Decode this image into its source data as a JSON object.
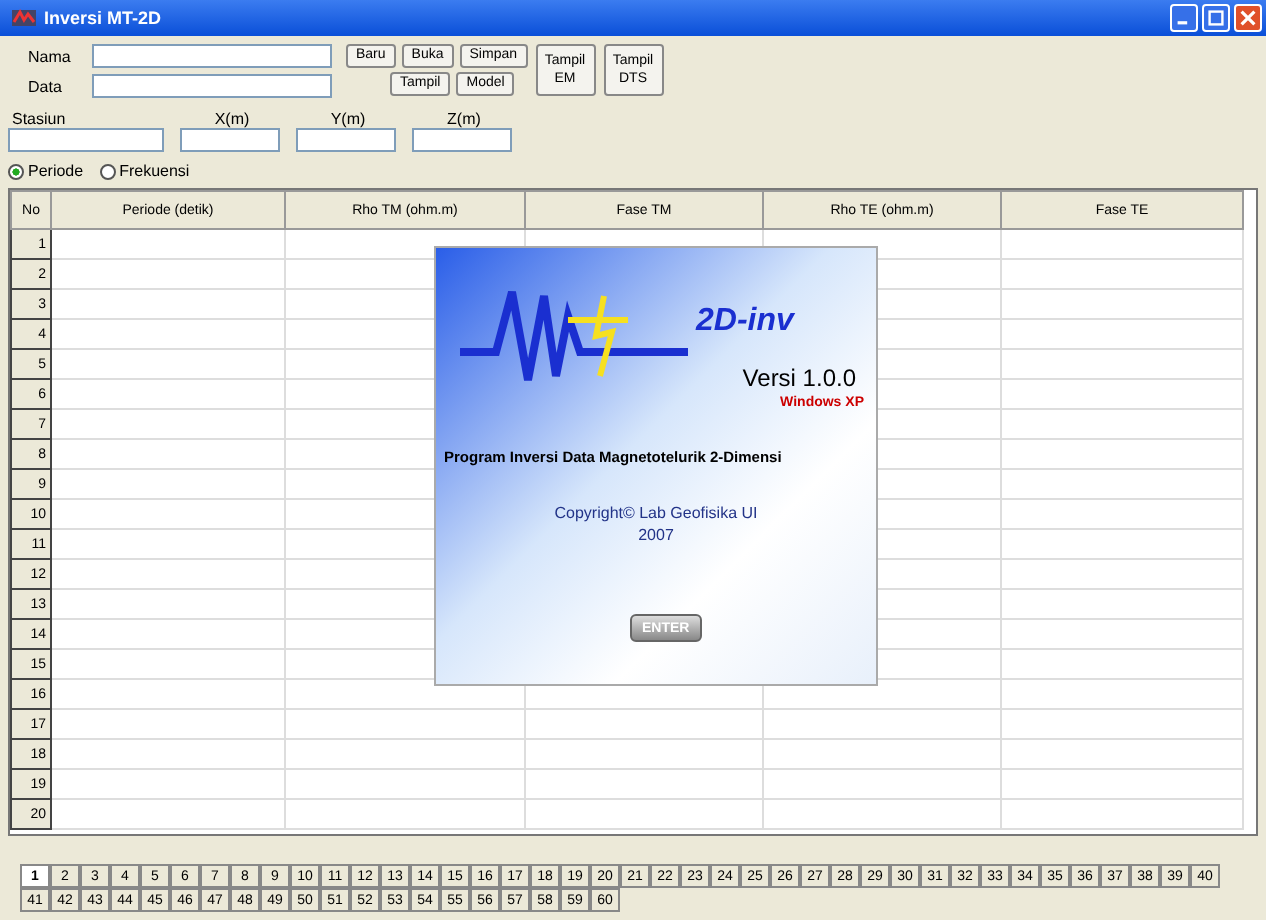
{
  "window": {
    "title": "Inversi MT-2D"
  },
  "form": {
    "name_label": "Nama",
    "data_label": "Data",
    "buttons_row1": [
      "Baru",
      "Buka",
      "Simpan"
    ],
    "buttons_row2": [
      "Tampil",
      "Model"
    ],
    "big_buttons": [
      "Tampil EM",
      "Tampil DTS"
    ],
    "station_fields": [
      {
        "label": "Stasiun"
      },
      {
        "label": "X(m)"
      },
      {
        "label": "Y(m)"
      },
      {
        "label": "Z(m)"
      }
    ],
    "radios": [
      {
        "label": "Periode",
        "selected": true
      },
      {
        "label": "Frekuensi",
        "selected": false
      }
    ]
  },
  "table": {
    "columns": [
      "No",
      "Periode (detik)",
      "Rho TM (ohm.m)",
      "Fase TM",
      "Rho TE (ohm.m)",
      "Fase TE"
    ],
    "rows": [
      "1",
      "2",
      "3",
      "4",
      "5",
      "6",
      "7",
      "8",
      "9",
      "10",
      "11",
      "12",
      "13",
      "14",
      "15",
      "16",
      "17",
      "18",
      "19",
      "20"
    ]
  },
  "splash": {
    "logo": "2D-inv",
    "version": "Versi 1.0.0",
    "platform": "Windows XP",
    "program": "Program Inversi Data Magnetotelurik 2-Dimensi",
    "copyright": "Copyright© Lab Geofisika UI",
    "year": "2007",
    "button": "ENTER"
  },
  "station_tabs": [
    {
      "label": "1",
      "selected": true
    },
    {
      "label": "2",
      "selected": false
    },
    {
      "label": "3",
      "selected": false
    },
    {
      "label": "4",
      "selected": false
    },
    {
      "label": "5",
      "selected": false
    },
    {
      "label": "6",
      "selected": false
    },
    {
      "label": "7",
      "selected": false
    },
    {
      "label": "8",
      "selected": false
    },
    {
      "label": "9",
      "selected": false
    },
    {
      "label": "10",
      "selected": false
    },
    {
      "label": "11",
      "selected": false
    },
    {
      "label": "12",
      "selected": false
    },
    {
      "label": "13",
      "selected": false
    },
    {
      "label": "14",
      "selected": false
    },
    {
      "label": "15",
      "selected": false
    },
    {
      "label": "16",
      "selected": false
    },
    {
      "label": "17",
      "selected": false
    },
    {
      "label": "18",
      "selected": false
    },
    {
      "label": "19",
      "selected": false
    },
    {
      "label": "20",
      "selected": false
    },
    {
      "label": "21",
      "selected": false
    },
    {
      "label": "22",
      "selected": false
    },
    {
      "label": "23",
      "selected": false
    },
    {
      "label": "24",
      "selected": false
    },
    {
      "label": "25",
      "selected": false
    },
    {
      "label": "26",
      "selected": false
    },
    {
      "label": "27",
      "selected": false
    },
    {
      "label": "28",
      "selected": false
    },
    {
      "label": "29",
      "selected": false
    },
    {
      "label": "30",
      "selected": false
    },
    {
      "label": "31",
      "selected": false
    },
    {
      "label": "32",
      "selected": false
    },
    {
      "label": "33",
      "selected": false
    },
    {
      "label": "34",
      "selected": false
    },
    {
      "label": "35",
      "selected": false
    },
    {
      "label": "36",
      "selected": false
    },
    {
      "label": "37",
      "selected": false
    },
    {
      "label": "38",
      "selected": false
    },
    {
      "label": "39",
      "selected": false
    },
    {
      "label": "40",
      "selected": false
    },
    {
      "label": "41",
      "selected": false
    },
    {
      "label": "42",
      "selected": false
    },
    {
      "label": "43",
      "selected": false
    },
    {
      "label": "44",
      "selected": false
    },
    {
      "label": "45",
      "selected": false
    },
    {
      "label": "46",
      "selected": false
    },
    {
      "label": "47",
      "selected": false
    },
    {
      "label": "48",
      "selected": false
    },
    {
      "label": "49",
      "selected": false
    },
    {
      "label": "50",
      "selected": false
    },
    {
      "label": "51",
      "selected": false
    },
    {
      "label": "52",
      "selected": false
    },
    {
      "label": "53",
      "selected": false
    },
    {
      "label": "54",
      "selected": false
    },
    {
      "label": "55",
      "selected": false
    },
    {
      "label": "56",
      "selected": false
    },
    {
      "label": "57",
      "selected": false
    },
    {
      "label": "58",
      "selected": false
    },
    {
      "label": "59",
      "selected": false
    },
    {
      "label": "60",
      "selected": false
    }
  ]
}
